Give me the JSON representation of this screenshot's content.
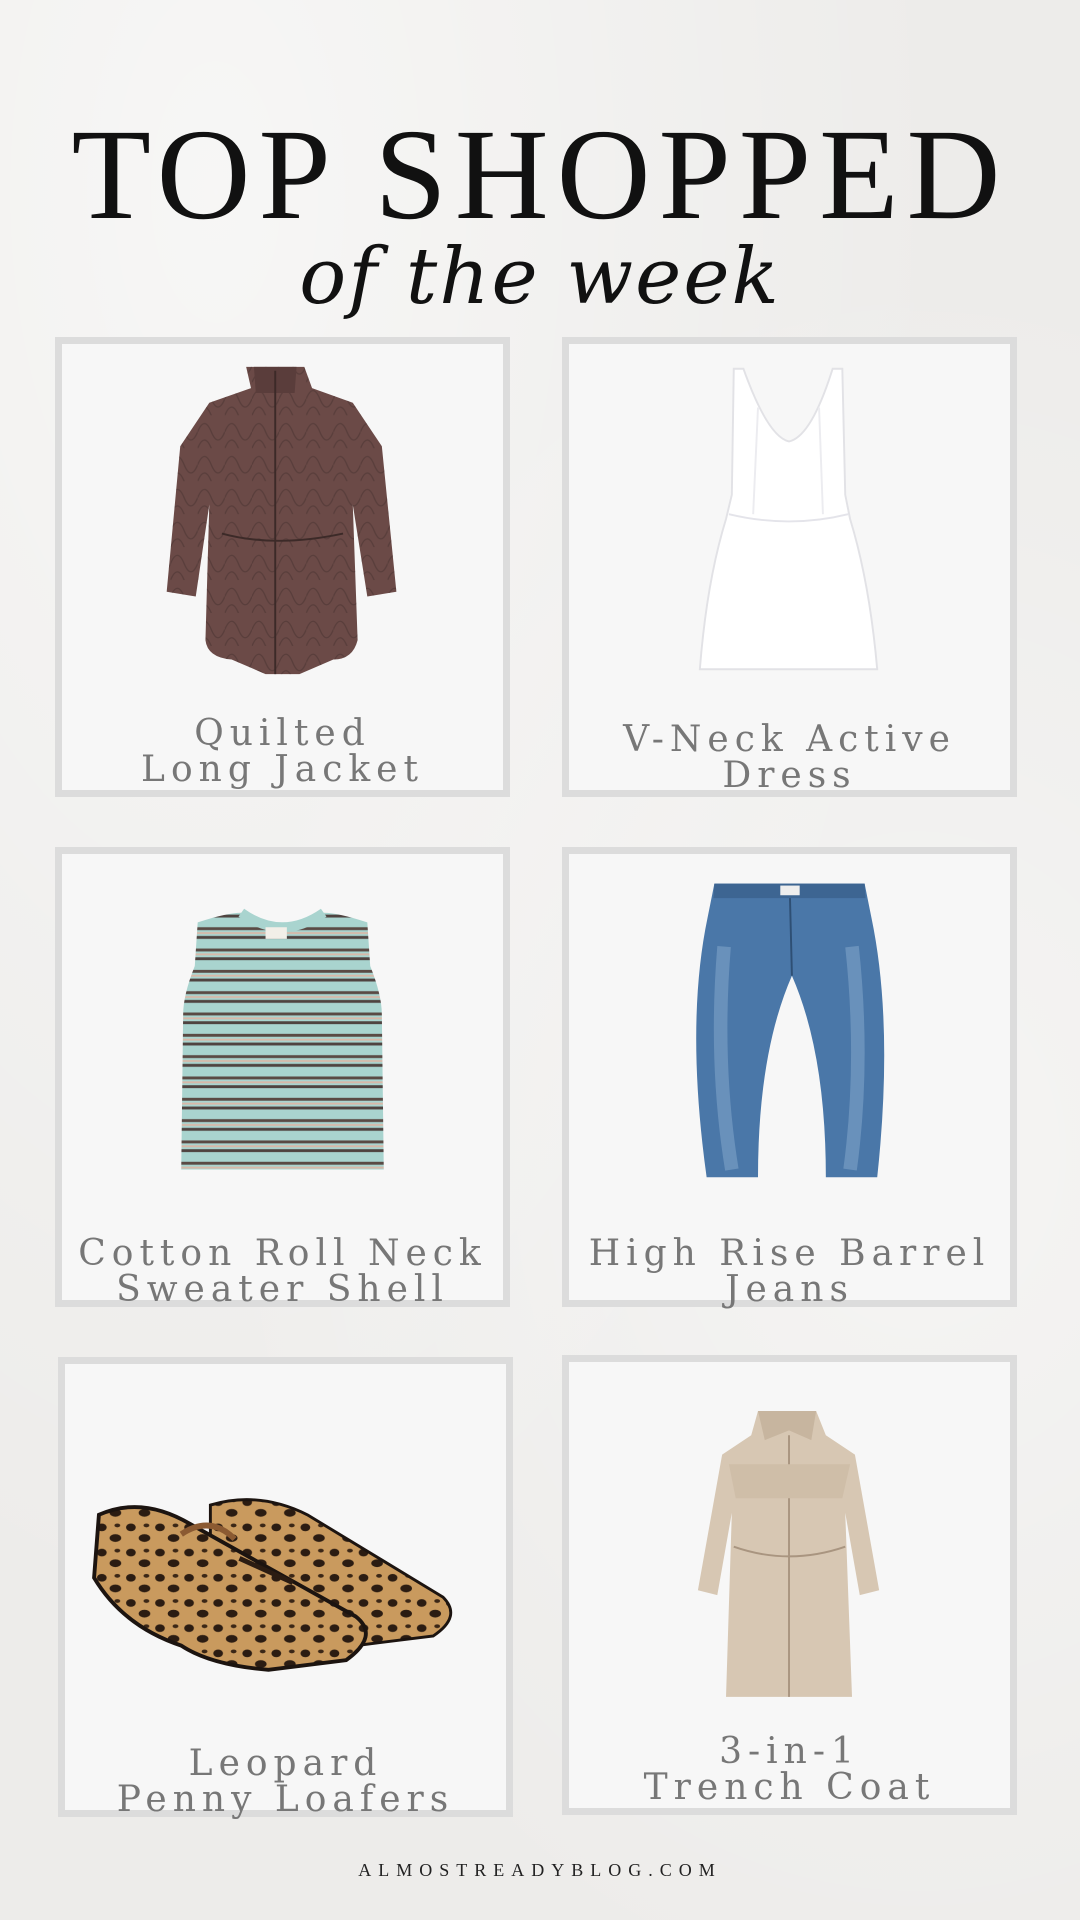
{
  "header": {
    "title": "TOP SHOPPED",
    "subtitle": "of the week"
  },
  "products": [
    {
      "line1": "Quilted",
      "line2": "Long Jacket",
      "image": "quilted-jacket-image"
    },
    {
      "line1": "V-Neck Active",
      "line2": "Dress",
      "image": "white-dress-image"
    },
    {
      "line1": "Cotton Roll Neck",
      "line2": "Sweater Shell",
      "image": "striped-sweater-image"
    },
    {
      "line1": "High Rise Barrel",
      "line2": "Jeans",
      "image": "barrel-jeans-image"
    },
    {
      "line1": "Leopard",
      "line2": "Penny Loafers",
      "image": "leopard-loafers-image"
    },
    {
      "line1": "3-in-1",
      "line2": "Trench Coat",
      "image": "trench-coat-image"
    }
  ],
  "footer": {
    "site": "ALMOSTREADYBLOG.COM"
  },
  "colors": {
    "background": "#edecea",
    "card": "#f7f7f7",
    "card_border": "#dcdcdc",
    "label": "#777777",
    "title": "#111111"
  }
}
